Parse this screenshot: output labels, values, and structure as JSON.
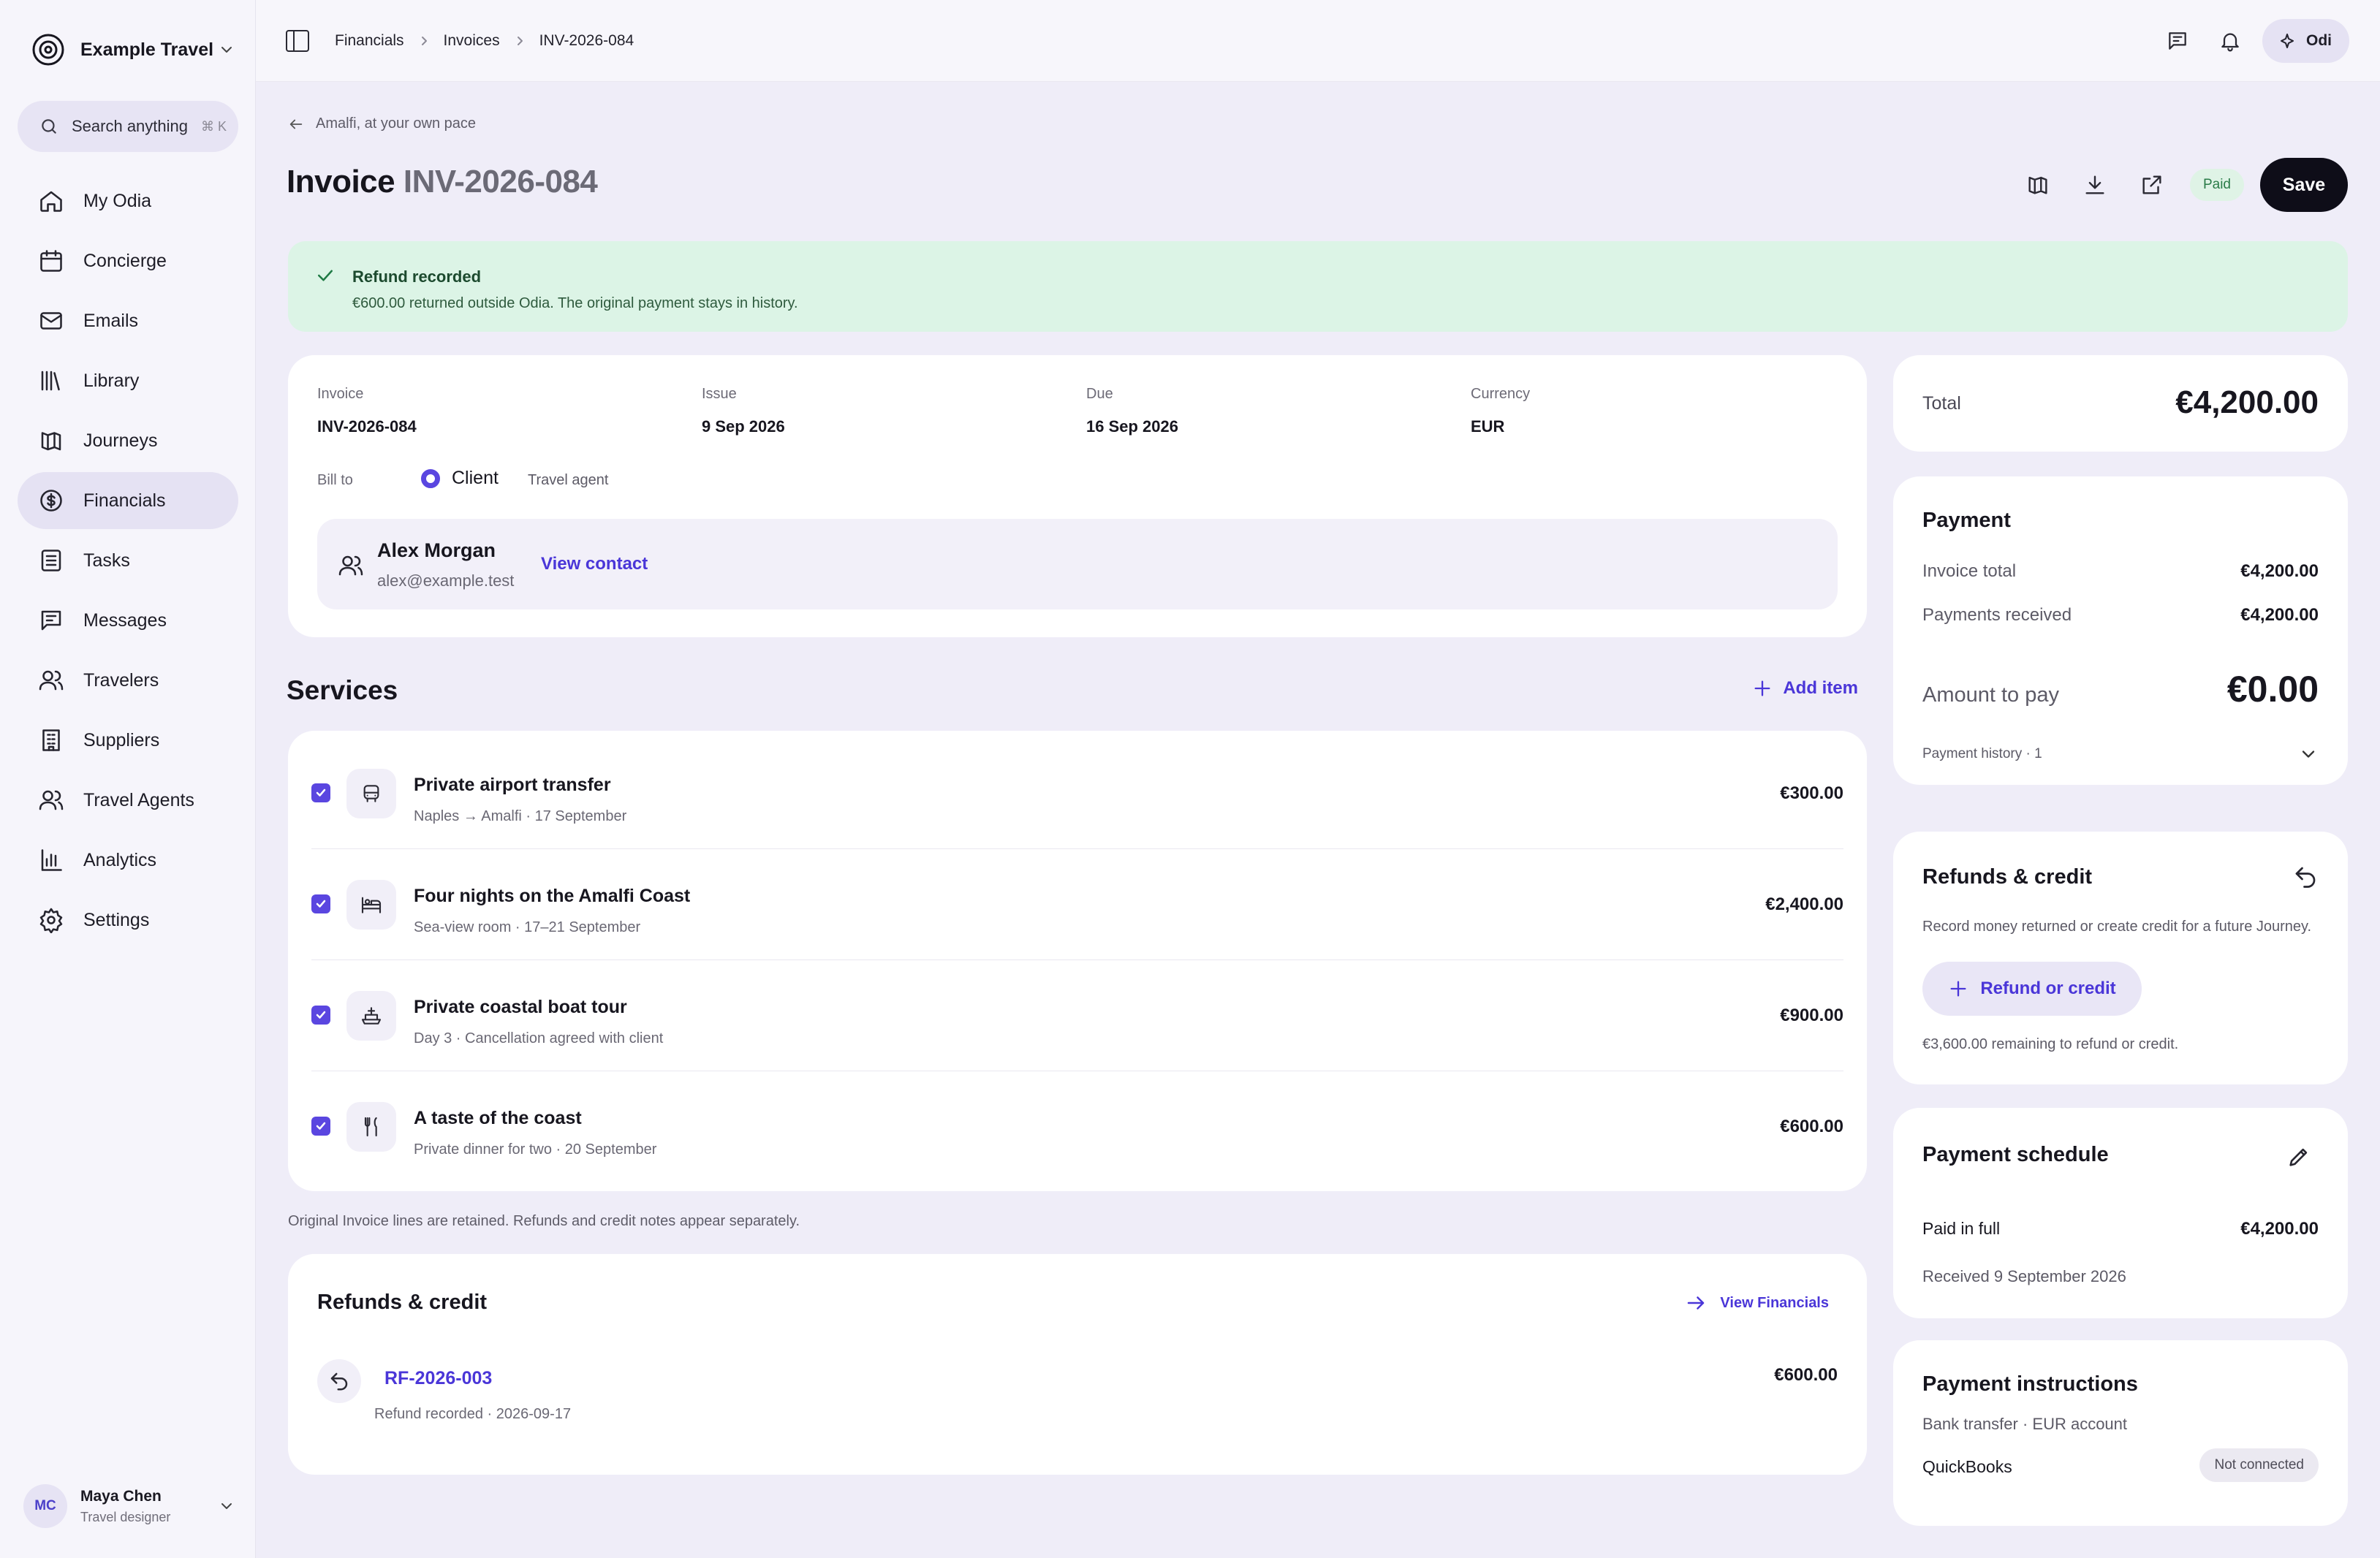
{
  "brand": {
    "name": "Example Travel"
  },
  "search": {
    "placeholder": "Search anything",
    "shortcut": "⌘ K"
  },
  "sidebar": {
    "items": [
      {
        "label": "My Odia",
        "icon": "home-icon"
      },
      {
        "label": "Concierge",
        "icon": "calendar-icon"
      },
      {
        "label": "Emails",
        "icon": "mail-icon"
      },
      {
        "label": "Library",
        "icon": "library-icon"
      },
      {
        "label": "Journeys",
        "icon": "map-icon"
      },
      {
        "label": "Financials",
        "icon": "dollar-icon",
        "active": true
      },
      {
        "label": "Tasks",
        "icon": "list-icon"
      },
      {
        "label": "Messages",
        "icon": "message-icon"
      },
      {
        "label": "Travelers",
        "icon": "users-icon"
      },
      {
        "label": "Suppliers",
        "icon": "building-icon"
      },
      {
        "label": "Travel Agents",
        "icon": "users-icon"
      },
      {
        "label": "Analytics",
        "icon": "chart-icon"
      },
      {
        "label": "Settings",
        "icon": "gear-icon"
      }
    ]
  },
  "user": {
    "initials": "MC",
    "name": "Maya Chen",
    "role": "Travel designer"
  },
  "breadcrumb": [
    "Financials",
    "Invoices",
    "INV-2026-084"
  ],
  "topbar": {
    "assistant_label": "Odi"
  },
  "page": {
    "back_label": "Amalfi, at your own pace",
    "title_prefix": "Invoice",
    "title_number": "INV-2026-084",
    "status_badge": "Paid",
    "save_label": "Save"
  },
  "banner": {
    "title": "Refund recorded",
    "body": "€600.00 returned outside Odia. The original payment stays in history."
  },
  "invoice": {
    "fields": [
      {
        "label": "Invoice",
        "value": "INV-2026-084"
      },
      {
        "label": "Issue",
        "value": "9 Sep 2026"
      },
      {
        "label": "Due",
        "value": "16 Sep 2026"
      },
      {
        "label": "Currency",
        "value": "EUR"
      }
    ],
    "bill_to_label": "Bill to",
    "bill_to_selected": "Client",
    "bill_to_other": "Travel agent",
    "contact": {
      "name": "Alex Morgan",
      "email": "alex@example.test",
      "link": "View contact"
    }
  },
  "services": {
    "title": "Services",
    "add_label": "Add item",
    "items": [
      {
        "title": "Private airport transfer",
        "sub": "Naples → Amalfi · 17 September",
        "amount": "€300.00",
        "icon": "car-icon",
        "checked": true
      },
      {
        "title": "Four nights on the Amalfi Coast",
        "sub": "Sea-view room · 17–21 September",
        "amount": "€2,400.00",
        "icon": "bed-icon",
        "checked": true
      },
      {
        "title": "Private coastal boat tour",
        "sub": "Day 3 · Cancellation agreed with client",
        "amount": "€900.00",
        "icon": "boat-icon",
        "checked": true
      },
      {
        "title": "A taste of the coast",
        "sub": "Private dinner for two · 20 September",
        "amount": "€600.00",
        "icon": "cutlery-icon",
        "checked": true
      }
    ],
    "note": "Original Invoice lines are retained. Refunds and credit notes appear separately."
  },
  "refunds_section": {
    "title": "Refunds & credit",
    "link": "View Financials",
    "entry": {
      "id": "RF-2026-003",
      "sub": "Refund recorded · 2026-09-17",
      "amount": "€600.00"
    }
  },
  "summary": {
    "total_label": "Total",
    "total_value": "€4,200.00"
  },
  "payment": {
    "title": "Payment",
    "invoice_total_label": "Invoice total",
    "invoice_total": "€4,200.00",
    "received_label": "Payments received",
    "received": "€4,200.00",
    "due_label": "Amount to pay",
    "due": "€0.00",
    "history_label": "Payment history · 1"
  },
  "refund_panel": {
    "title": "Refunds & credit",
    "description": "Record money returned or create credit for a future Journey.",
    "button": "Refund or credit",
    "remaining": "€3,600.00 remaining to refund or credit."
  },
  "schedule": {
    "title": "Payment schedule",
    "row_label": "Paid in full",
    "row_value": "€4,200.00",
    "received": "Received 9 September 2026"
  },
  "instructions": {
    "title": "Payment instructions",
    "sub": "Bank transfer · EUR account",
    "integration": "QuickBooks",
    "integration_status": "Not connected"
  },
  "colors": {
    "accent": "#5a46e0",
    "link": "#4a36d8",
    "success_bg": "#dcf4e6",
    "primary_button": "#0e0d18"
  }
}
